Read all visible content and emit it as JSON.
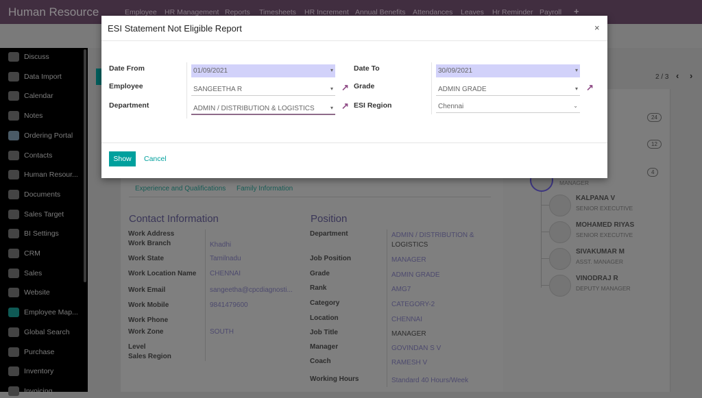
{
  "app": {
    "title": "Human Resource",
    "menu": [
      "Employee",
      "HR Management",
      "Reports",
      "Timesheets",
      "HR Increment",
      "Annual Benefits",
      "Attendances",
      "Leaves",
      "Hr Reminder",
      "Payroll",
      "+"
    ],
    "pager": "2 / 3"
  },
  "sidebar": {
    "items": [
      "Discuss",
      "Data Import",
      "Calendar",
      "Notes",
      "Ordering Portal",
      "Contacts",
      "Human Resour...",
      "Documents",
      "Sales Target",
      "BI Settings",
      "CRM",
      "Sales",
      "Website",
      "Employee Map...",
      "Global Search",
      "Purchase",
      "Inventory",
      "Invoicing"
    ]
  },
  "tabs": [
    "Experience and Qualifications",
    "Family Information"
  ],
  "contact": {
    "title": "Contact Information",
    "rows": [
      [
        "Work Address",
        ""
      ],
      [
        "Work Branch",
        "Khadhi"
      ],
      [
        "Work State",
        "Tamilnadu"
      ],
      [
        "Work Location Name",
        "CHENNAI"
      ],
      [
        "Work Email",
        "sangeetha@cpcdiagnosti..."
      ],
      [
        "Work Mobile",
        "9841479600"
      ],
      [
        "Work Phone",
        ""
      ],
      [
        "Work Zone",
        "SOUTH"
      ],
      [
        "Level",
        ""
      ],
      [
        "Sales Region",
        ""
      ]
    ]
  },
  "position": {
    "title": "Position",
    "rows": [
      [
        "Department",
        "ADMIN / DISTRIBUTION &",
        "LOGISTICS"
      ],
      [
        "Job Position",
        "MANAGER"
      ],
      [
        "Grade",
        "ADMIN GRADE"
      ],
      [
        "Rank",
        "AMG7"
      ],
      [
        "Category",
        "CATEGORY-2"
      ],
      [
        "Location",
        "CHENNAI"
      ],
      [
        "Job Title",
        "MANAGER"
      ],
      [
        "Manager",
        "GOVINDAN S V"
      ],
      [
        "Coach",
        "RAMESH V"
      ],
      [
        "Working Hours",
        "Standard 40 Hours/Week"
      ]
    ]
  },
  "org": {
    "badges": [
      "24",
      "12",
      "4"
    ],
    "manager_partial": "R",
    "manager_title": "MANAGER",
    "subordinates": [
      {
        "name": "KALPANA V",
        "title": "SENIOR EXECUTIVE"
      },
      {
        "name": "MOHAMED RIYAS",
        "title": "SENIOR EXECUTIVE"
      },
      {
        "name": "SIVAKUMAR M",
        "title": "ASST. MANAGER"
      },
      {
        "name": "VINODRAJ R",
        "title": "DEPUTY MANAGER"
      }
    ]
  },
  "modal": {
    "title": "ESI Statement Not Eligible Report",
    "close": "×",
    "date_from_label": "Date From",
    "date_from": "01/09/2021",
    "date_to_label": "Date To",
    "date_to": "30/09/2021",
    "employee_label": "Employee",
    "employee": "SANGEETHA R",
    "grade_label": "Grade",
    "grade": "ADMIN GRADE",
    "department_label": "Department",
    "department": "ADMIN / DISTRIBUTION & LOGISTICS",
    "esi_region_label": "ESI Region",
    "esi_region": "Chennai",
    "show": "Show",
    "cancel": "Cancel"
  },
  "colors": {
    "accent": "#00a09d",
    "topbar": "#412e40",
    "required_field": "#d2d2fa"
  }
}
